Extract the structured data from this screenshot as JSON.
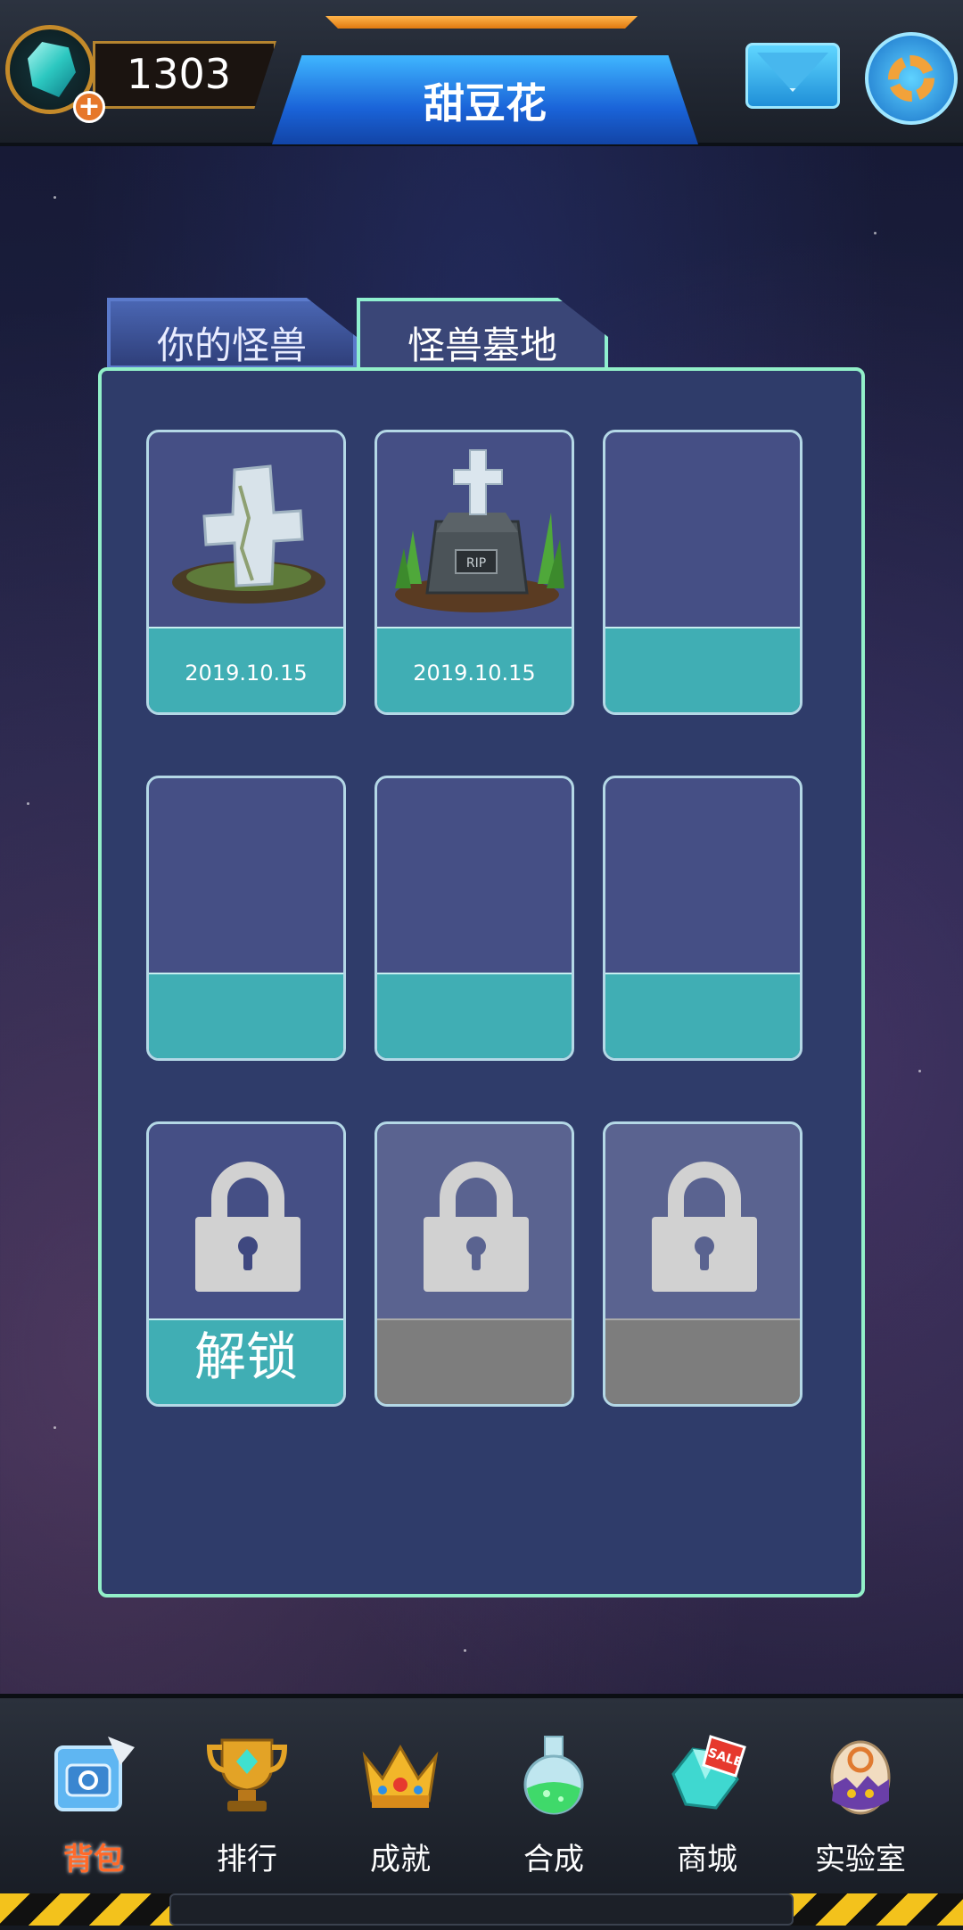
{
  "header": {
    "currency_value": "1303",
    "title": "甜豆花"
  },
  "tabs": [
    {
      "label": "你的怪兽",
      "active": false
    },
    {
      "label": "怪兽墓地",
      "active": true
    }
  ],
  "slots": {
    "row1": [
      {
        "date": "2019.10.15",
        "icon": "tombstone-cross-icon"
      },
      {
        "date": "2019.10.15",
        "icon": "grave-stone-cross-icon"
      },
      {
        "date": ""
      }
    ],
    "row3": {
      "unlock_label": "解锁"
    }
  },
  "nav": {
    "items": [
      {
        "label": "背包",
        "icon": "backpack-icon",
        "active": true
      },
      {
        "label": "排行",
        "icon": "trophy-icon"
      },
      {
        "label": "成就",
        "icon": "crown-icon"
      },
      {
        "label": "合成",
        "icon": "potion-flask-icon"
      },
      {
        "label": "商城",
        "icon": "gem-sale-icon"
      },
      {
        "label": "实验室",
        "icon": "egg-icon"
      }
    ]
  },
  "colors": {
    "panel_border": "#92f0c9",
    "slot_footer": "#40aeb4",
    "title_plate": "#1a63d8",
    "active_nav": "#ff6a2a"
  }
}
